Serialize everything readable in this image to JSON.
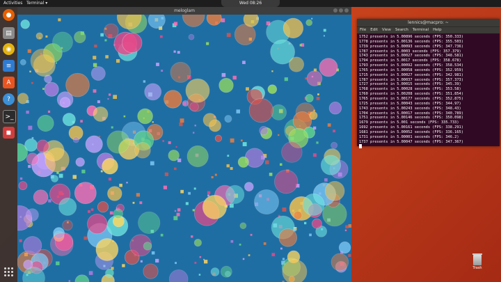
{
  "topbar": {
    "activities": "Activities",
    "app_menu": "Terminal ▾",
    "clock": "Wed 08:26"
  },
  "dock": {
    "items": [
      {
        "icon": "firefox-icon",
        "color": "#e66000"
      },
      {
        "icon": "files-icon",
        "color": "#9b9b9b"
      },
      {
        "icon": "rhythmbox-icon",
        "color": "#e3b20f"
      },
      {
        "icon": "writer-icon",
        "color": "#2d7bd3"
      },
      {
        "icon": "software-icon",
        "color": "#e95420"
      },
      {
        "icon": "help-icon",
        "color": "#3b8fd6"
      },
      {
        "icon": "terminal-icon",
        "color": "#2c2c2c"
      },
      {
        "icon": "recorder-icon",
        "color": "#d43d3d"
      }
    ]
  },
  "window": {
    "title": "meloglam"
  },
  "terminal": {
    "title": "lennics@macpro: ~",
    "menu": [
      "File",
      "Edit",
      "View",
      "Search",
      "Terminal",
      "Help"
    ],
    "lines": [
      "1752 presents in 5.00896 seconds (FPS: 350.333)",
      "1778 presents in 5.00136 seconds (FPS: 355.503)",
      "1739 presents in 5.00093 seconds (FPS: 347.736)",
      "1787 presents in 5.0003 seconds (FPS: 357.379)",
      "1743 presents in 5.00027 seconds (FPS: 348.581)",
      "1794 presents in 5.0017 seconds (FPS: 358.678)",
      "1793 presents in 5.00092 seconds (FPS: 358.534)",
      "1765 presents in 5.00058 seconds (FPS: 352.959)",
      "1715 presents in 5.00027 seconds (FPS: 342.981)",
      "1787 presents in 5.00037 seconds (FPS: 357.373)",
      "1727 presents in 5.00015 seconds (FPS: 345.39)",
      "1768 presents in 5.00028 seconds (FPS: 353.58)",
      "1760 presents in 5.00208 seconds (FPS: 351.854)",
      "1765 presents in 5.00177 seconds (FPS: 352.875)",
      "1725 presents in 5.00043 seconds (FPS: 344.97)",
      "1743 presents in 5.00243 seconds (FPS: 348.43)",
      "1704 presents in 5.00017 seconds (FPS: 340.789)",
      "1751 presents in 5.00146 seconds (FPS: 350.098)",
      "1679 presents in 5.001 seconds (FPS: 335.733)",
      "1692 presents in 5.00161 seconds (FPS: 338.291)",
      "1681 presents in 5.00052 seconds (FPS: 336.165)",
      "1731 presents in 5.00001 seconds (FPS: 346.2)",
      "1737 presents in 5.00047 seconds (FPS: 347.367)"
    ]
  },
  "desktop": {
    "trash_label": "Trash"
  },
  "colors": {
    "canvas_bg": "#1f6ea3",
    "terminal_bg": "#300a24",
    "desktop_accent": "#e2582a"
  }
}
